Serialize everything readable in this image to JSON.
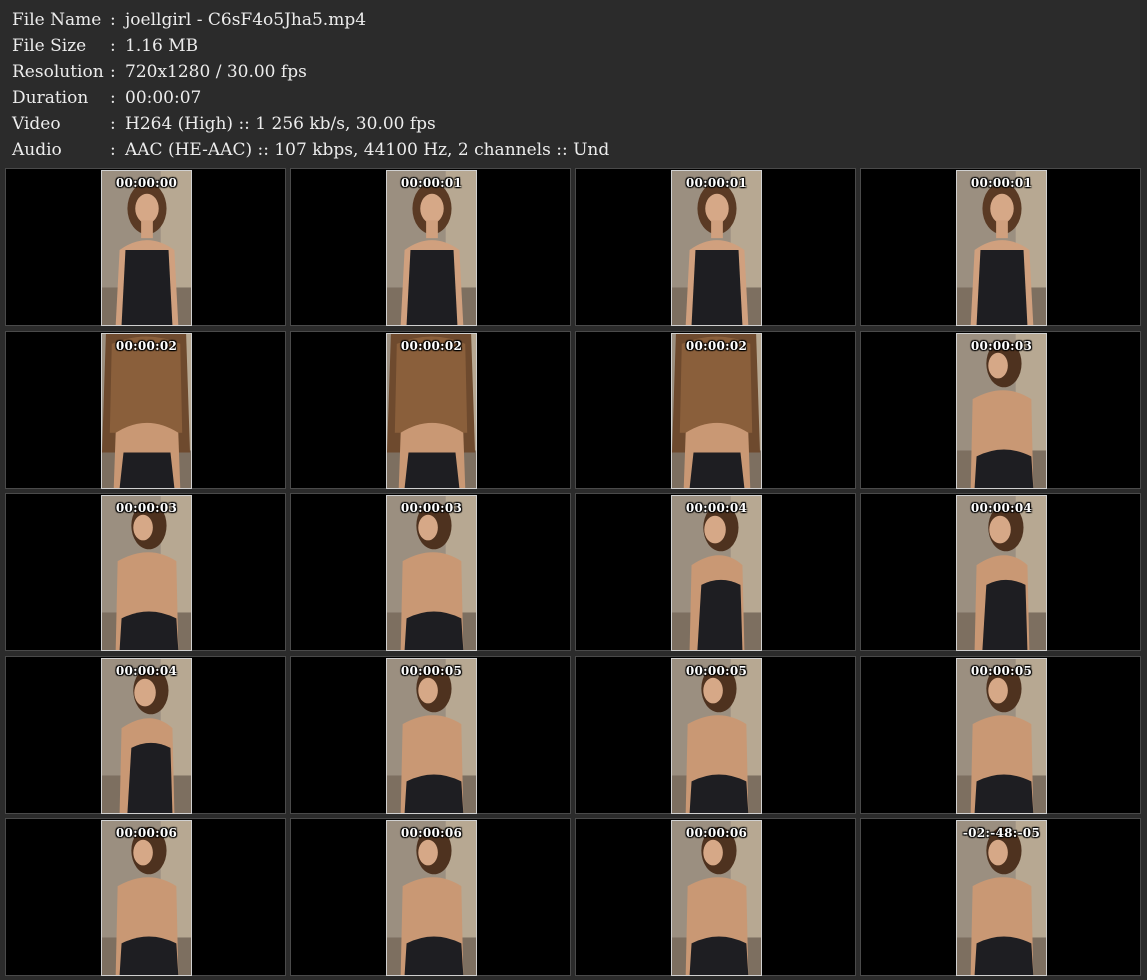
{
  "info": [
    {
      "label": "File Name",
      "value": "joellgirl - C6sF4o5Jha5.mp4"
    },
    {
      "label": "File Size",
      "value": "1.16 MB"
    },
    {
      "label": "Resolution",
      "value": "720x1280 / 30.00 fps"
    },
    {
      "label": "Duration",
      "value": "00:00:07"
    },
    {
      "label": "Video",
      "value": "H264 (High) :: 1 256 kb/s, 30.00 fps"
    },
    {
      "label": "Audio",
      "value": "AAC (HE-AAC) :: 107 kbps, 44100 Hz, 2 channels :: Und"
    }
  ],
  "separator": ":",
  "frames": [
    {
      "timestamp": "00:00:00",
      "pose": "front"
    },
    {
      "timestamp": "00:00:01",
      "pose": "front"
    },
    {
      "timestamp": "00:00:01",
      "pose": "front"
    },
    {
      "timestamp": "00:00:01",
      "pose": "front"
    },
    {
      "timestamp": "00:00:02",
      "pose": "hair-back"
    },
    {
      "timestamp": "00:00:02",
      "pose": "hair-back"
    },
    {
      "timestamp": "00:00:02",
      "pose": "hair-back"
    },
    {
      "timestamp": "00:00:03",
      "pose": "back-turn"
    },
    {
      "timestamp": "00:00:03",
      "pose": "back-turn"
    },
    {
      "timestamp": "00:00:03",
      "pose": "back-turn"
    },
    {
      "timestamp": "00:00:04",
      "pose": "side"
    },
    {
      "timestamp": "00:00:04",
      "pose": "side"
    },
    {
      "timestamp": "00:00:04",
      "pose": "side"
    },
    {
      "timestamp": "00:00:05",
      "pose": "back-turn"
    },
    {
      "timestamp": "00:00:05",
      "pose": "back-turn"
    },
    {
      "timestamp": "00:00:05",
      "pose": "back-turn"
    },
    {
      "timestamp": "00:00:06",
      "pose": "back-turn"
    },
    {
      "timestamp": "00:00:06",
      "pose": "back-turn"
    },
    {
      "timestamp": "00:00:06",
      "pose": "back-turn"
    },
    {
      "timestamp": "-02:-48:-05",
      "pose": "back-turn"
    }
  ],
  "colors": {
    "background": "#2b2b2b",
    "text": "#ececec",
    "cell": "#000000"
  }
}
